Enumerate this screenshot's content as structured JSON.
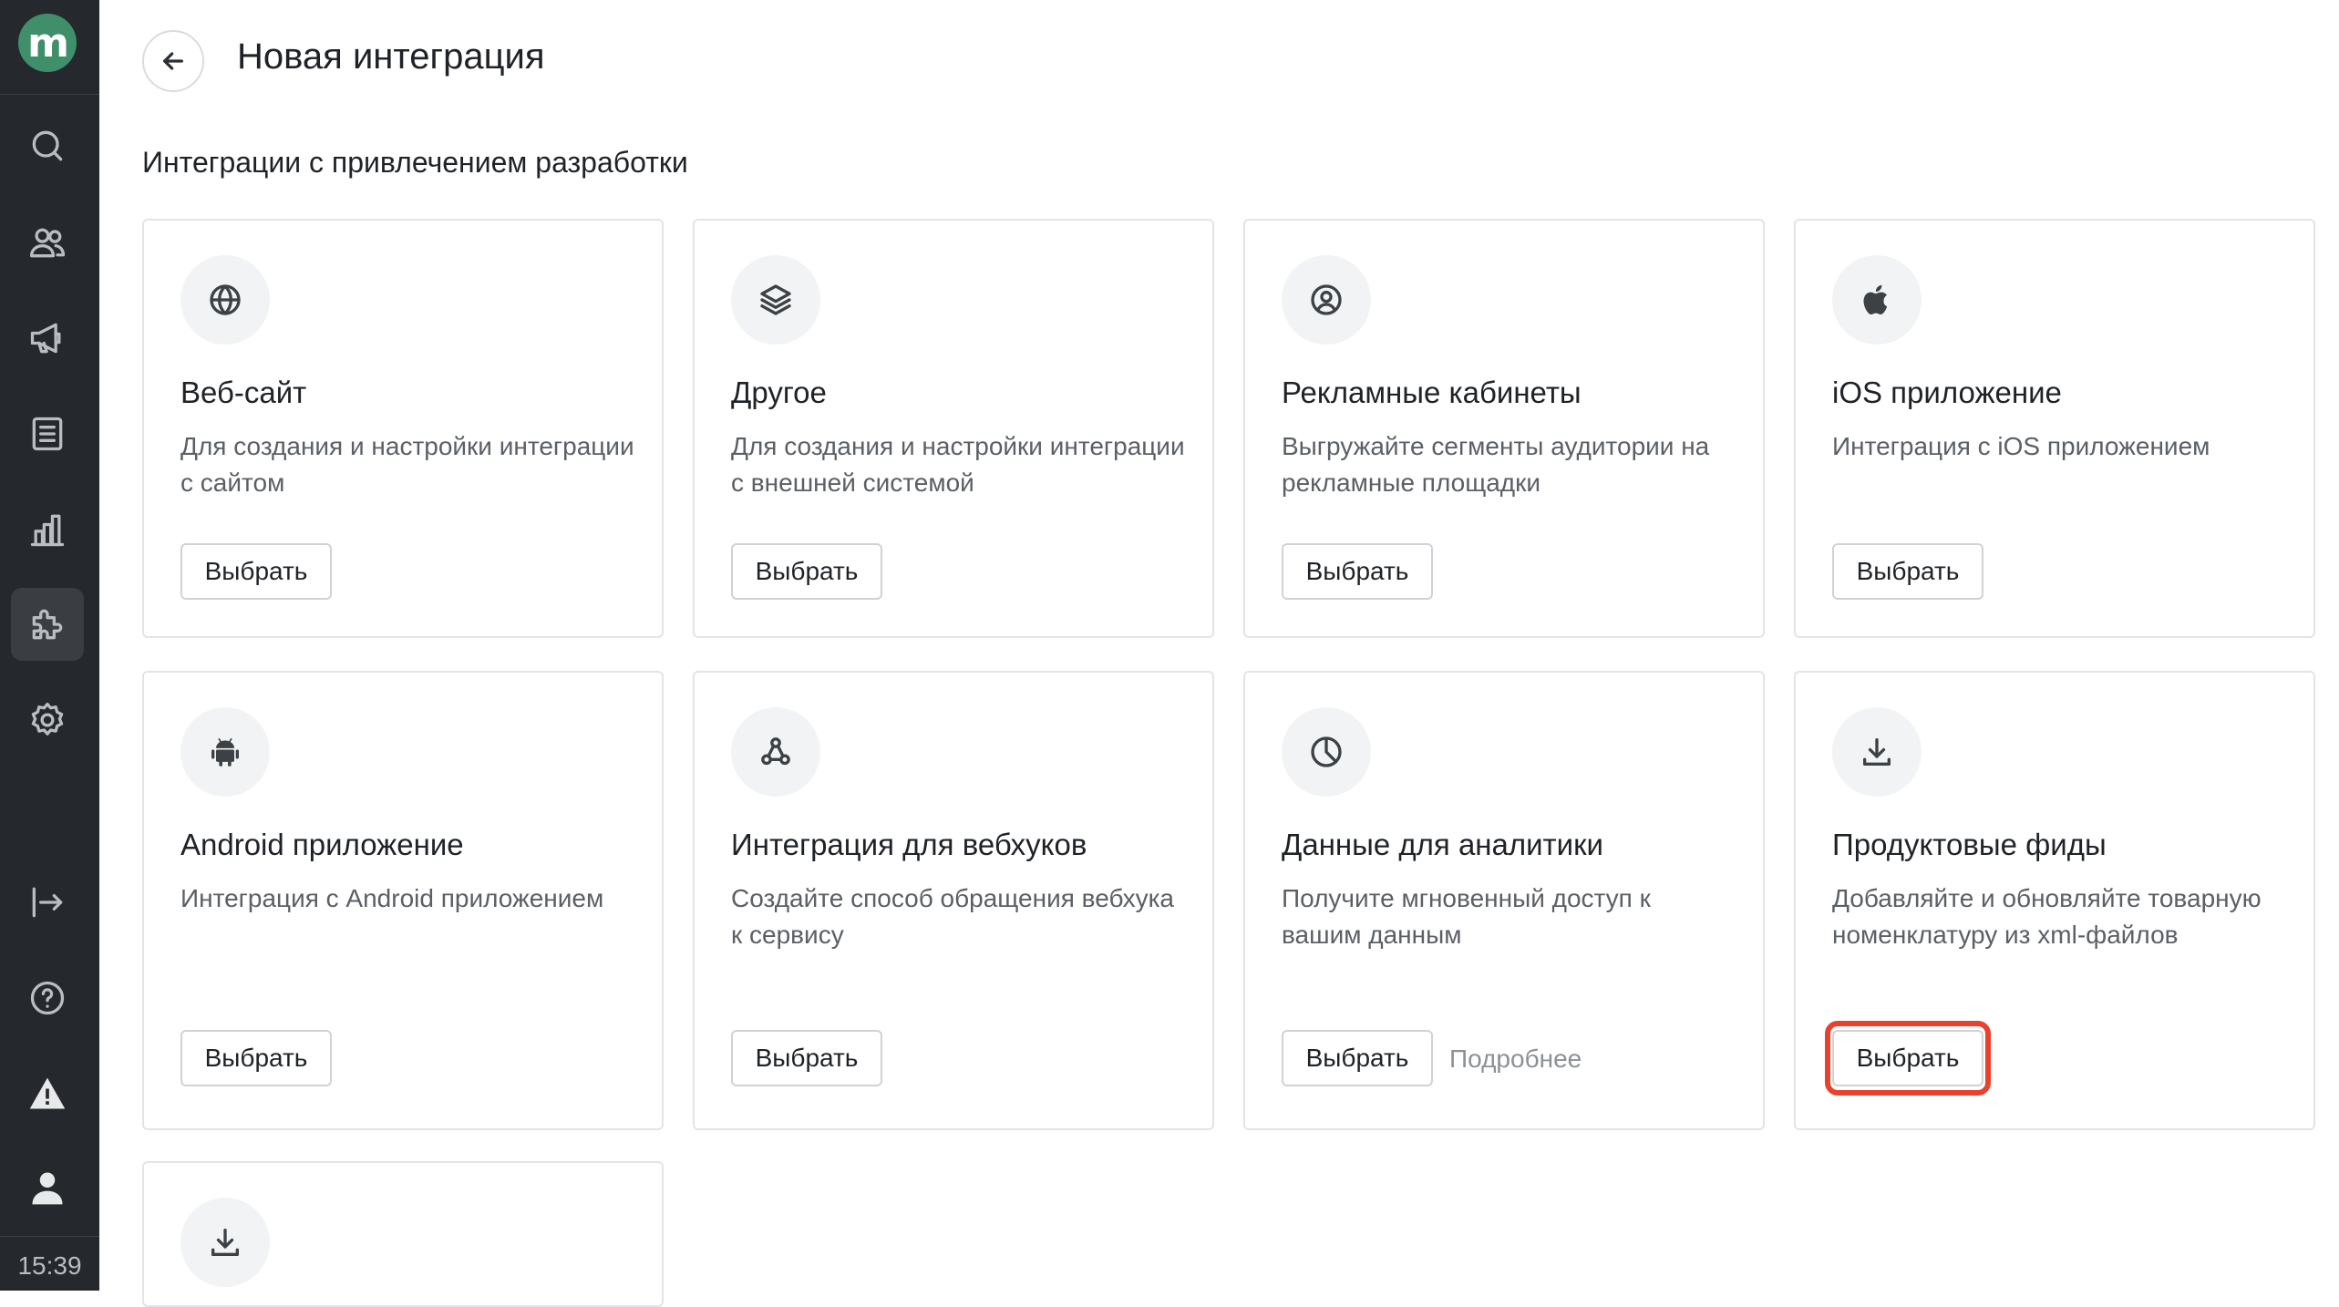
{
  "sidebar": {
    "logo_text": "m",
    "items": [
      {
        "name": "search",
        "icon": "search-icon"
      },
      {
        "name": "audience",
        "icon": "users-icon"
      },
      {
        "name": "campaigns",
        "icon": "megaphone-icon"
      },
      {
        "name": "content",
        "icon": "document-icon"
      },
      {
        "name": "analytics",
        "icon": "bar-chart-icon"
      },
      {
        "name": "integrations",
        "icon": "puzzle-icon",
        "active": true
      },
      {
        "name": "settings",
        "icon": "gear-icon"
      },
      {
        "name": "logout",
        "icon": "logout-icon"
      },
      {
        "name": "help",
        "icon": "help-icon"
      },
      {
        "name": "alerts",
        "icon": "warning-icon"
      },
      {
        "name": "profile",
        "icon": "user-icon"
      }
    ],
    "time": "15:39"
  },
  "header": {
    "title": "Новая интеграция"
  },
  "section": {
    "title": "Интеграции с привлечением разработки"
  },
  "cards": [
    {
      "title": "Веб-сайт",
      "description": "Для создания и настройки интеграции с сайтом",
      "button": "Выбрать",
      "icon": "globe-icon"
    },
    {
      "title": "Другое",
      "description": "Для создания и настройки интеграции с внешней системой",
      "button": "Выбрать",
      "icon": "layers-icon"
    },
    {
      "title": "Рекламные кабинеты",
      "description": "Выгружайте сегменты аудитории на рекламные площадки",
      "button": "Выбрать",
      "icon": "user-circle-icon"
    },
    {
      "title": "iOS приложение",
      "description": "Интеграция с iOS приложением",
      "button": "Выбрать",
      "icon": "apple-icon"
    },
    {
      "title": "Android приложение",
      "description": "Интеграция с Android приложением",
      "button": "Выбрать",
      "icon": "android-icon"
    },
    {
      "title": "Интеграция для вебхуков",
      "description": "Создайте способ обращения вебхука к сервису",
      "button": "Выбрать",
      "icon": "webhook-icon"
    },
    {
      "title": "Данные для аналитики",
      "description": "Получите мгновенный доступ к вашим данным",
      "button": "Выбрать",
      "link": "Подробнее",
      "icon": "pie-chart-icon"
    },
    {
      "title": "Продуктовые фиды",
      "description": "Добавляйте и обновляйте товарную номенклатуру из xml-файлов",
      "button": "Выбрать",
      "icon": "download-icon",
      "highlighted": true
    },
    {
      "title": "",
      "description": "",
      "button": "",
      "icon": "download-icon"
    }
  ],
  "colors": {
    "sidebar_bg": "#25282c",
    "logo_green": "#3f8f6a",
    "highlight_red": "#e8412d"
  }
}
